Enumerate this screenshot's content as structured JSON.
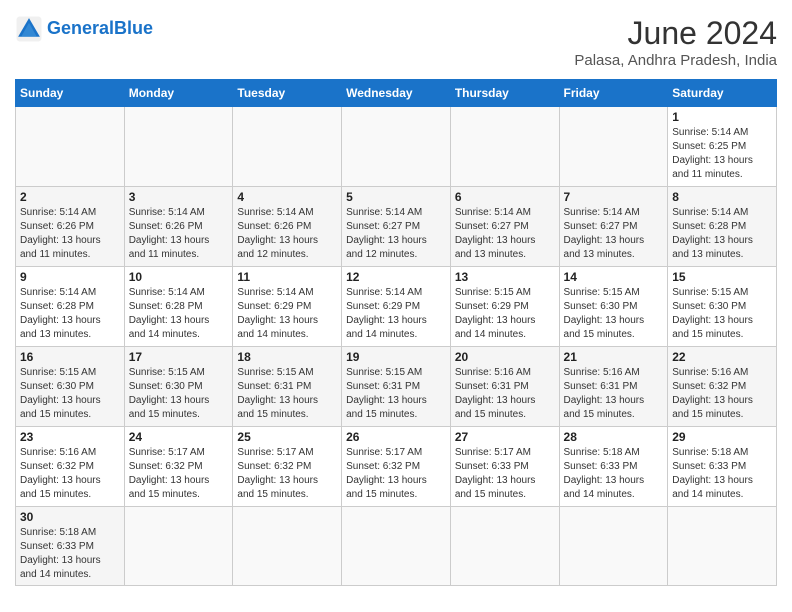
{
  "header": {
    "logo_general": "General",
    "logo_blue": "Blue",
    "month_year": "June 2024",
    "location": "Palasa, Andhra Pradesh, India"
  },
  "weekdays": [
    "Sunday",
    "Monday",
    "Tuesday",
    "Wednesday",
    "Thursday",
    "Friday",
    "Saturday"
  ],
  "weeks": [
    [
      {
        "day": "",
        "sunrise": "",
        "sunset": "",
        "daylight": ""
      },
      {
        "day": "",
        "sunrise": "",
        "sunset": "",
        "daylight": ""
      },
      {
        "day": "",
        "sunrise": "",
        "sunset": "",
        "daylight": ""
      },
      {
        "day": "",
        "sunrise": "",
        "sunset": "",
        "daylight": ""
      },
      {
        "day": "",
        "sunrise": "",
        "sunset": "",
        "daylight": ""
      },
      {
        "day": "",
        "sunrise": "",
        "sunset": "",
        "daylight": ""
      },
      {
        "day": "1",
        "sunrise": "Sunrise: 5:14 AM",
        "sunset": "Sunset: 6:25 PM",
        "daylight": "Daylight: 13 hours and 11 minutes."
      }
    ],
    [
      {
        "day": "2",
        "sunrise": "Sunrise: 5:14 AM",
        "sunset": "Sunset: 6:26 PM",
        "daylight": "Daylight: 13 hours and 11 minutes."
      },
      {
        "day": "3",
        "sunrise": "Sunrise: 5:14 AM",
        "sunset": "Sunset: 6:26 PM",
        "daylight": "Daylight: 13 hours and 11 minutes."
      },
      {
        "day": "4",
        "sunrise": "Sunrise: 5:14 AM",
        "sunset": "Sunset: 6:26 PM",
        "daylight": "Daylight: 13 hours and 12 minutes."
      },
      {
        "day": "5",
        "sunrise": "Sunrise: 5:14 AM",
        "sunset": "Sunset: 6:27 PM",
        "daylight": "Daylight: 13 hours and 12 minutes."
      },
      {
        "day": "6",
        "sunrise": "Sunrise: 5:14 AM",
        "sunset": "Sunset: 6:27 PM",
        "daylight": "Daylight: 13 hours and 13 minutes."
      },
      {
        "day": "7",
        "sunrise": "Sunrise: 5:14 AM",
        "sunset": "Sunset: 6:27 PM",
        "daylight": "Daylight: 13 hours and 13 minutes."
      },
      {
        "day": "8",
        "sunrise": "Sunrise: 5:14 AM",
        "sunset": "Sunset: 6:28 PM",
        "daylight": "Daylight: 13 hours and 13 minutes."
      }
    ],
    [
      {
        "day": "9",
        "sunrise": "Sunrise: 5:14 AM",
        "sunset": "Sunset: 6:28 PM",
        "daylight": "Daylight: 13 hours and 13 minutes."
      },
      {
        "day": "10",
        "sunrise": "Sunrise: 5:14 AM",
        "sunset": "Sunset: 6:28 PM",
        "daylight": "Daylight: 13 hours and 14 minutes."
      },
      {
        "day": "11",
        "sunrise": "Sunrise: 5:14 AM",
        "sunset": "Sunset: 6:29 PM",
        "daylight": "Daylight: 13 hours and 14 minutes."
      },
      {
        "day": "12",
        "sunrise": "Sunrise: 5:14 AM",
        "sunset": "Sunset: 6:29 PM",
        "daylight": "Daylight: 13 hours and 14 minutes."
      },
      {
        "day": "13",
        "sunrise": "Sunrise: 5:15 AM",
        "sunset": "Sunset: 6:29 PM",
        "daylight": "Daylight: 13 hours and 14 minutes."
      },
      {
        "day": "14",
        "sunrise": "Sunrise: 5:15 AM",
        "sunset": "Sunset: 6:30 PM",
        "daylight": "Daylight: 13 hours and 15 minutes."
      },
      {
        "day": "15",
        "sunrise": "Sunrise: 5:15 AM",
        "sunset": "Sunset: 6:30 PM",
        "daylight": "Daylight: 13 hours and 15 minutes."
      }
    ],
    [
      {
        "day": "16",
        "sunrise": "Sunrise: 5:15 AM",
        "sunset": "Sunset: 6:30 PM",
        "daylight": "Daylight: 13 hours and 15 minutes."
      },
      {
        "day": "17",
        "sunrise": "Sunrise: 5:15 AM",
        "sunset": "Sunset: 6:30 PM",
        "daylight": "Daylight: 13 hours and 15 minutes."
      },
      {
        "day": "18",
        "sunrise": "Sunrise: 5:15 AM",
        "sunset": "Sunset: 6:31 PM",
        "daylight": "Daylight: 13 hours and 15 minutes."
      },
      {
        "day": "19",
        "sunrise": "Sunrise: 5:15 AM",
        "sunset": "Sunset: 6:31 PM",
        "daylight": "Daylight: 13 hours and 15 minutes."
      },
      {
        "day": "20",
        "sunrise": "Sunrise: 5:16 AM",
        "sunset": "Sunset: 6:31 PM",
        "daylight": "Daylight: 13 hours and 15 minutes."
      },
      {
        "day": "21",
        "sunrise": "Sunrise: 5:16 AM",
        "sunset": "Sunset: 6:31 PM",
        "daylight": "Daylight: 13 hours and 15 minutes."
      },
      {
        "day": "22",
        "sunrise": "Sunrise: 5:16 AM",
        "sunset": "Sunset: 6:32 PM",
        "daylight": "Daylight: 13 hours and 15 minutes."
      }
    ],
    [
      {
        "day": "23",
        "sunrise": "Sunrise: 5:16 AM",
        "sunset": "Sunset: 6:32 PM",
        "daylight": "Daylight: 13 hours and 15 minutes."
      },
      {
        "day": "24",
        "sunrise": "Sunrise: 5:17 AM",
        "sunset": "Sunset: 6:32 PM",
        "daylight": "Daylight: 13 hours and 15 minutes."
      },
      {
        "day": "25",
        "sunrise": "Sunrise: 5:17 AM",
        "sunset": "Sunset: 6:32 PM",
        "daylight": "Daylight: 13 hours and 15 minutes."
      },
      {
        "day": "26",
        "sunrise": "Sunrise: 5:17 AM",
        "sunset": "Sunset: 6:32 PM",
        "daylight": "Daylight: 13 hours and 15 minutes."
      },
      {
        "day": "27",
        "sunrise": "Sunrise: 5:17 AM",
        "sunset": "Sunset: 6:33 PM",
        "daylight": "Daylight: 13 hours and 15 minutes."
      },
      {
        "day": "28",
        "sunrise": "Sunrise: 5:18 AM",
        "sunset": "Sunset: 6:33 PM",
        "daylight": "Daylight: 13 hours and 14 minutes."
      },
      {
        "day": "29",
        "sunrise": "Sunrise: 5:18 AM",
        "sunset": "Sunset: 6:33 PM",
        "daylight": "Daylight: 13 hours and 14 minutes."
      }
    ],
    [
      {
        "day": "30",
        "sunrise": "Sunrise: 5:18 AM",
        "sunset": "Sunset: 6:33 PM",
        "daylight": "Daylight: 13 hours and 14 minutes."
      },
      {
        "day": "",
        "sunrise": "",
        "sunset": "",
        "daylight": ""
      },
      {
        "day": "",
        "sunrise": "",
        "sunset": "",
        "daylight": ""
      },
      {
        "day": "",
        "sunrise": "",
        "sunset": "",
        "daylight": ""
      },
      {
        "day": "",
        "sunrise": "",
        "sunset": "",
        "daylight": ""
      },
      {
        "day": "",
        "sunrise": "",
        "sunset": "",
        "daylight": ""
      },
      {
        "day": "",
        "sunrise": "",
        "sunset": "",
        "daylight": ""
      }
    ]
  ]
}
